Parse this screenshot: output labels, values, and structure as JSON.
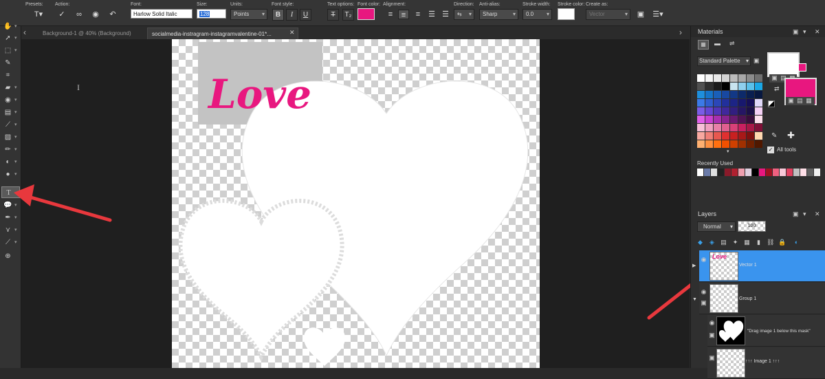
{
  "options_bar": {
    "presets_label": "Presets:",
    "action_label": "Action:",
    "font_label": "Font:",
    "font_value": "Harlow Solid Italic",
    "size_label": "Size:",
    "size_value": "128",
    "units_label": "Units:",
    "units_value": "Points",
    "font_style_label": "Font style:",
    "text_options_label": "Text options:",
    "font_color_label": "Font color:",
    "font_color": "#e8177f",
    "alignment_label": "Alignment:",
    "direction_label": "Direction:",
    "anti_alias_label": "Anti-alias:",
    "anti_alias_value": "Sharp",
    "stroke_width_label": "Stroke width:",
    "stroke_width_value": "0.0",
    "stroke_color_label": "Stroke color:",
    "stroke_color": "#ffffff",
    "create_as_label": "Create as:",
    "create_as_value": "Vector",
    "bold_label": "B",
    "italic_label": "I",
    "underline_label": "U",
    "strike_label": "T",
    "sub_label": "T₂"
  },
  "tabs": [
    {
      "label": "Background-1 @  40% (Background)",
      "active": false
    },
    {
      "label": "socialmedia-instragram-instagramvalentine-01*...",
      "active": true
    }
  ],
  "tab_nav_left": "‹",
  "tab_nav_right": "›",
  "tab_close": "✕",
  "canvas": {
    "text": "Love",
    "text_color": "#e8177f"
  },
  "materials": {
    "title": "Materials",
    "palette_dropdown": "Standard Palette",
    "all_tools_label": "All tools",
    "recently_used_label": "Recently Used",
    "foreground_color": "#ffffff",
    "background_color": "#e8177f",
    "palette_rows": [
      [
        "#ffffff",
        "#f4f4f4",
        "#e8e8e8",
        "#d4d4d4",
        "#bdbdbd",
        "#a8a8a8",
        "#8c8c8c",
        "#707070"
      ],
      [
        "#505050",
        "#2e2e2e",
        "#1a1a1a",
        "#000000",
        "#c8e4f0",
        "#8fd0ee",
        "#5ac0ea",
        "#1aa7e6"
      ],
      [
        "#1e8fdc",
        "#1674c8",
        "#1a5fb8",
        "#1848a0",
        "#123886",
        "#0d2a6a",
        "#0a1f50",
        "#081840"
      ],
      [
        "#3b7ae8",
        "#2f5ed0",
        "#2b47b8",
        "#22309c",
        "#1c2486",
        "#18186e",
        "#160f58",
        "#e0d8f8"
      ],
      [
        "#7a5ce6",
        "#6446d4",
        "#5036b8",
        "#40289c",
        "#321e80",
        "#261664",
        "#1c1048",
        "#f4d0f4"
      ],
      [
        "#e060e8",
        "#c840d0",
        "#a830b0",
        "#882490",
        "#6a1a70",
        "#501454",
        "#3a0e3c",
        "#fce0ec"
      ],
      [
        "#f8c0d8",
        "#f0a0c0",
        "#e880a8",
        "#e06090",
        "#d84078",
        "#c82060",
        "#a81848",
        "#801038"
      ],
      [
        "#f8a8a0",
        "#f08078",
        "#e85850",
        "#e03030",
        "#c82020",
        "#a81818",
        "#801010",
        "#ffd8b0"
      ],
      [
        "#ffb070",
        "#ff9040",
        "#ff7010",
        "#f05000",
        "#d04000",
        "#a03000",
        "#702000",
        "#501800"
      ]
    ],
    "recent_colors": [
      "#ffffff",
      "#6b7ba8",
      "#e0e0e0",
      "#222222",
      "#8a1a2a",
      "#b02030",
      "#f0a0b0",
      "#e0d0e0",
      "#000000",
      "#e8177f",
      "#a01020",
      "#f06080",
      "#f8c8d8",
      "#e04060",
      "#c0c0c0",
      "#ffe0e8",
      "#606060",
      "#f0f0f0"
    ]
  },
  "layers": {
    "title": "Layers",
    "blend_mode": "Normal",
    "opacity": "100",
    "items": [
      {
        "name": "Vector 1",
        "selected": true
      },
      {
        "name": "Group 1",
        "selected": false
      },
      {
        "name": "\"Drag image 1 below this mask\"",
        "selected": false
      },
      {
        "name": "↑↑↑ Image 1 ↑↑↑",
        "selected": false
      }
    ]
  },
  "arrow_color": "#e8383d"
}
